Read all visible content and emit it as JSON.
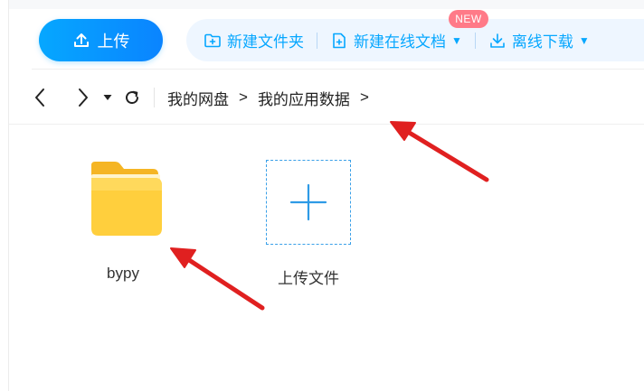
{
  "toolbar": {
    "upload_label": "上传",
    "new_folder_label": "新建文件夹",
    "new_online_doc_label": "新建在线文档",
    "new_badge": "NEW",
    "offline_download_label": "离线下载"
  },
  "nav": {
    "breadcrumb": [
      "我的网盘",
      "我的应用数据"
    ],
    "separator": ">"
  },
  "files": [
    {
      "name": "bypy",
      "type": "folder"
    }
  ],
  "upload_tile": {
    "label": "上传文件"
  },
  "colors": {
    "accent": "#06a7ff",
    "annotation": "#e02020",
    "folder": "#ffc933"
  }
}
